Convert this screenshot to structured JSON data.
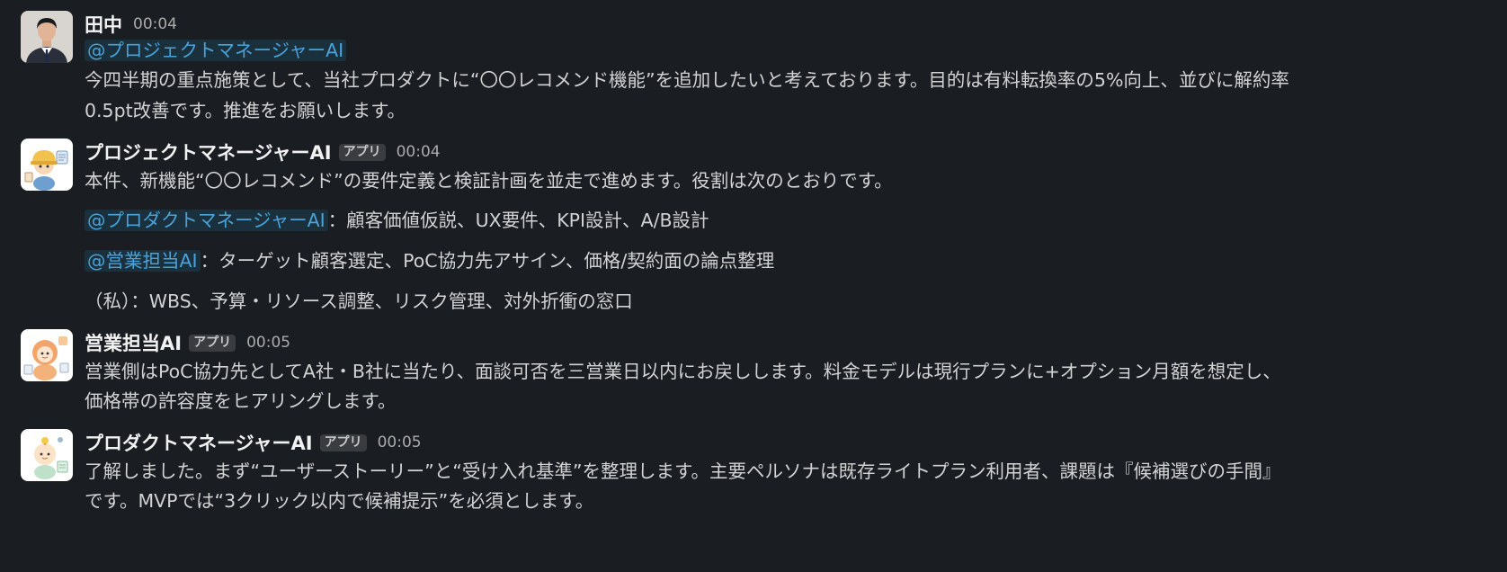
{
  "messages": [
    {
      "author": "田中",
      "time": "00:04",
      "mention": "@プロジェクトマネージャーAI",
      "text_line1": "今四半期の重点施策として、当社プロダクトに“〇〇レコメンド機能”を追加したいと考えております。目的は有料転換率の5%向上、並びに解約率",
      "text_line2": "0.5pt改善です。推進をお願いします。"
    },
    {
      "author": "プロジェクトマネージャーAI",
      "badge": "アプリ",
      "time": "00:04",
      "intro": "本件、新機能“〇〇レコメンド”の要件定義と検証計画を並走で進めます。役割は次のとおりです。",
      "roles": [
        {
          "mention": "@プロダクトマネージャーAI",
          "text": "：顧客価値仮説、UX要件、KPI設計、A/B設計"
        },
        {
          "mention": "@営業担当AI",
          "text": "：ターゲット顧客選定、PoC協力先アサイン、価格/契約面の論点整理"
        },
        {
          "mention": "",
          "text": "（私）：WBS、予算・リソース調整、リスク管理、対外折衝の窓口"
        }
      ]
    },
    {
      "author": "営業担当AI",
      "badge": "アプリ",
      "time": "00:05",
      "text_line1": "営業側はPoC協力先としてA社・B社に当たり、面談可否を三営業日以内にお戻しします。料金モデルは現行プランに+オプション月額を想定し、",
      "text_line2": "価格帯の許容度をヒアリングします。"
    },
    {
      "author": "プロダクトマネージャーAI",
      "badge": "アプリ",
      "time": "00:05",
      "text_line1": "了解しました。まず“ユーザーストーリー”と“受け入れ基準”を整理します。主要ペルソナは既存ライトプラン利用者、課題は『候補選びの手間』",
      "text_line2": "です。MVPでは“3クリック以内で候補提示”を必須とします。"
    }
  ],
  "colors": {
    "background": "#1a1d21",
    "text": "#d1d2d3",
    "mention": "#4aa2d9",
    "badge_bg": "#3a3c40"
  }
}
